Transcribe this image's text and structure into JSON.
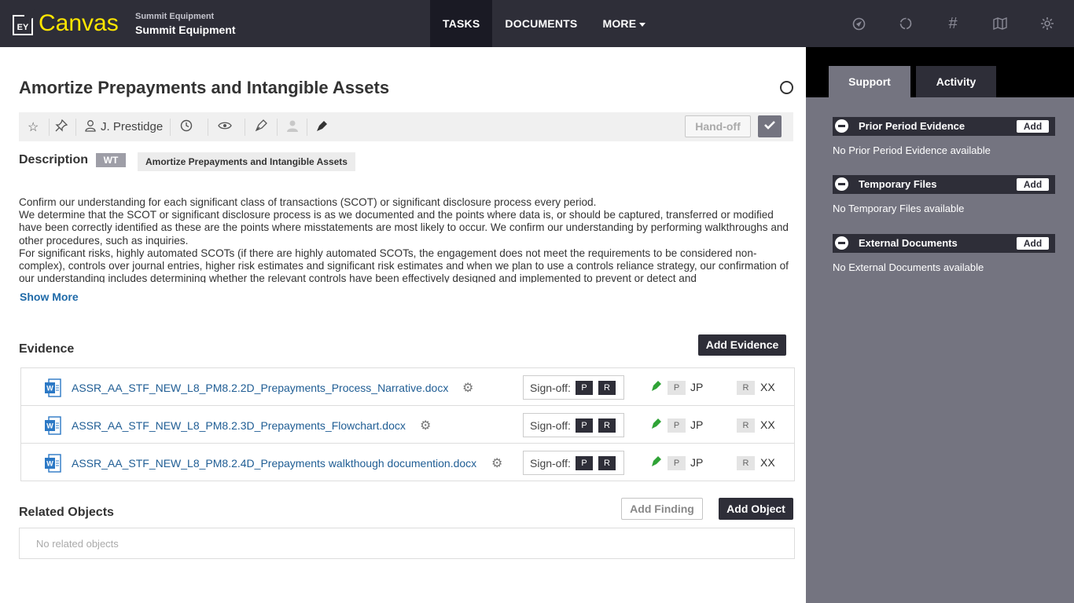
{
  "header": {
    "logo_text": "EY",
    "brand": "Canvas",
    "client_small": "Summit Equipment",
    "client_large": "Summit Equipment",
    "nav": [
      {
        "label": "TASKS",
        "active": true
      },
      {
        "label": "DOCUMENTS",
        "active": false
      },
      {
        "label": "MORE",
        "active": false
      }
    ],
    "icons": [
      "compass-icon",
      "sync-icon",
      "hashtag-icon",
      "map-icon",
      "settings-icon"
    ]
  },
  "task": {
    "title": "Amortize Prepayments and Intangible Assets",
    "assignee": "J. Prestidge",
    "handoff_label": "Hand-off"
  },
  "description": {
    "label": "Description",
    "badge": "WT",
    "tag": "Amortize Prepayments and Intangible Assets",
    "paragraphs": [
      "Confirm our understanding for each significant class of transactions (SCOT) or significant disclosure process every period.",
      "We determine that the SCOT or significant disclosure process is as we documented and the points where data is, or should be captured, transferred or modified have been correctly identified as these are the points where misstatements are most likely to occur. We confirm our understanding by performing walkthroughs and other procedures, such as inquiries.",
      "For significant risks, highly automated SCOTs (if there are highly automated SCOTs, the engagement does not meet the requirements to be considered non-complex), controls over journal entries, higher risk estimates and significant risk estimates and when we plan to use a controls reliance strategy, our confirmation of our understanding includes determining whether the relevant controls have been effectively designed and implemented to prevent or detect and"
    ],
    "show_more": "Show More"
  },
  "evidence": {
    "label": "Evidence",
    "add_label": "Add Evidence",
    "signoff_label": "Sign-off:",
    "items": [
      {
        "name": "ASSR_AA_STF_NEW_L8_PM8.2.2D_Prepayments_Process_Narrative.docx",
        "preparer": "JP",
        "reviewer": "XX"
      },
      {
        "name": "ASSR_AA_STF_NEW_L8_PM8.2.3D_Prepayments_Flowchart.docx",
        "preparer": "JP",
        "reviewer": "XX"
      },
      {
        "name": "ASSR_AA_STF_NEW_L8_PM8.2.4D_Prepayments walkthough documention.docx",
        "preparer": "JP",
        "reviewer": "XX"
      }
    ],
    "p_label": "P",
    "r_label": "R"
  },
  "related": {
    "label": "Related Objects",
    "add_finding": "Add Finding",
    "add_object": "Add Object",
    "empty": "No related objects"
  },
  "sidebar": {
    "tabs": [
      {
        "label": "Support",
        "active": true
      },
      {
        "label": "Activity",
        "active": false
      }
    ],
    "sections": [
      {
        "title": "Prior Period Evidence",
        "add": "Add",
        "empty": "No Prior Period Evidence available"
      },
      {
        "title": "Temporary Files",
        "add": "Add",
        "empty": "No Temporary Files available"
      },
      {
        "title": "External Documents",
        "add": "Add",
        "empty": "No External Documents available"
      }
    ]
  },
  "colors": {
    "header_bg": "#2e2e38",
    "brand_yellow": "#ffe600",
    "link_blue": "#1f5d94",
    "sidebar_bg": "#747480",
    "signoff_green": "#2fa336"
  }
}
